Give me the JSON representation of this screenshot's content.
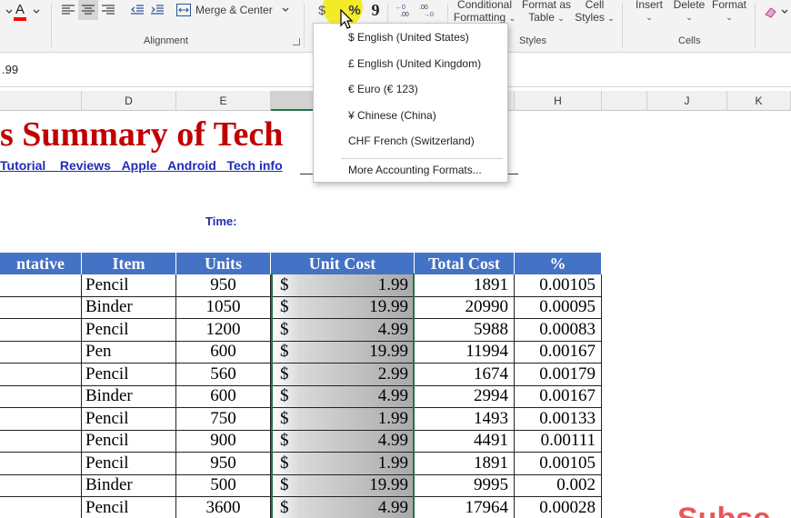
{
  "ribbon": {
    "merge_center": "Merge & Center",
    "group_alignment": "Alignment",
    "group_styles": "Styles",
    "group_cells": "Cells",
    "conditional_formatting": [
      "Conditional",
      "Formatting"
    ],
    "format_as_table": [
      "Format as",
      "Table"
    ],
    "cell_styles": [
      "Cell",
      "Styles"
    ],
    "insert": "Insert",
    "delete": "Delete",
    "format": "Format",
    "percent_symbol": "%",
    "comma_symbol": "9",
    "font_color_letter": "A"
  },
  "formula_bar": {
    "value": ".99"
  },
  "columns": [
    "D",
    "E",
    "H",
    "J",
    "K"
  ],
  "sheet": {
    "title": "s Summary of Tech",
    "subtitle": "Tutorial _ Reviews _Apple _Android _Tech info",
    "time_label": "Time:"
  },
  "table": {
    "headers": [
      "ntative",
      "Item",
      "Units",
      "Unit Cost",
      "Total Cost",
      "%"
    ],
    "currency_symbol": "$",
    "rows": [
      {
        "item": "Pencil",
        "units": "950",
        "unit_cost": "1.99",
        "total": "1891",
        "pct": "0.00105"
      },
      {
        "item": "Binder",
        "units": "1050",
        "unit_cost": "19.99",
        "total": "20990",
        "pct": "0.00095"
      },
      {
        "item": "Pencil",
        "units": "1200",
        "unit_cost": "4.99",
        "total": "5988",
        "pct": "0.00083"
      },
      {
        "item": "Pen",
        "units": "600",
        "unit_cost": "19.99",
        "total": "11994",
        "pct": "0.00167"
      },
      {
        "item": "Pencil",
        "units": "560",
        "unit_cost": "2.99",
        "total": "1674",
        "pct": "0.00179"
      },
      {
        "item": "Binder",
        "units": "600",
        "unit_cost": "4.99",
        "total": "2994",
        "pct": "0.00167"
      },
      {
        "item": "Pencil",
        "units": "750",
        "unit_cost": "1.99",
        "total": "1493",
        "pct": "0.00133"
      },
      {
        "item": "Pencil",
        "units": "900",
        "unit_cost": "4.99",
        "total": "4491",
        "pct": "0.00111"
      },
      {
        "item": "Pencil",
        "units": "950",
        "unit_cost": "1.99",
        "total": "1891",
        "pct": "0.00105"
      },
      {
        "item": "Binder",
        "units": "500",
        "unit_cost": "19.99",
        "total": "9995",
        "pct": "0.002"
      },
      {
        "item": "Pencil",
        "units": "3600",
        "unit_cost": "4.99",
        "total": "17964",
        "pct": "0.00028"
      }
    ]
  },
  "dropdown": {
    "items": [
      "$ English (United States)",
      "£ English (United Kingdom)",
      "€ Euro (€ 123)",
      "¥ Chinese (China)",
      "CHF French (Switzerland)"
    ],
    "more": "More Accounting Formats..."
  },
  "overlay": {
    "subscribe_text": "Subsc"
  },
  "colors": {
    "title_red": "#c00000",
    "subtitle_blue": "#1f2db4",
    "header_blue": "#4472c4",
    "selection_green": "#217346",
    "highlight_yellow": "#f2ea1f"
  }
}
